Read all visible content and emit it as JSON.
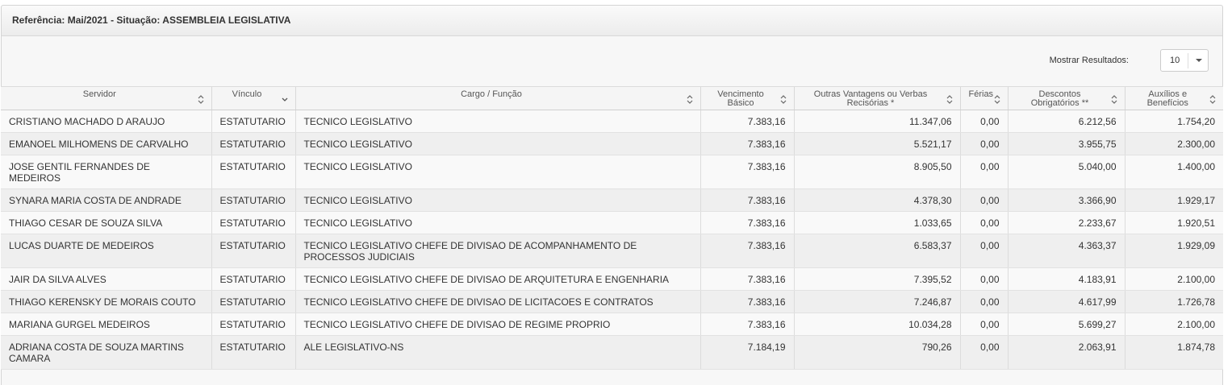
{
  "panel": {
    "title": "Referência: Mai/2021 - Situação: ASSEMBLEIA LEGISLATIVA"
  },
  "toolbar": {
    "show_results_label": "Mostrar Resultados:",
    "page_size": "10"
  },
  "table": {
    "columns": [
      {
        "label": "Servidor",
        "sort": "both"
      },
      {
        "label": "Vínculo",
        "sort": "down"
      },
      {
        "label": "Cargo / Função",
        "sort": "both"
      },
      {
        "label": "Vencimento Básico",
        "sort": "both"
      },
      {
        "label": "Outras Vantagens ou Verbas Recisórias *",
        "sort": "both"
      },
      {
        "label": "Férias",
        "sort": "both"
      },
      {
        "label": "Descontos Obrigatórios **",
        "sort": "both"
      },
      {
        "label": "Auxílios e Benefícios",
        "sort": "both"
      }
    ],
    "rows": [
      [
        "CRISTIANO MACHADO D ARAUJO",
        "ESTATUTARIO",
        "TECNICO LEGISLATIVO",
        "7.383,16",
        "11.347,06",
        "0,00",
        "6.212,56",
        "1.754,20"
      ],
      [
        "EMANOEL MILHOMENS DE CARVALHO",
        "ESTATUTARIO",
        "TECNICO LEGISLATIVO",
        "7.383,16",
        "5.521,17",
        "0,00",
        "3.955,75",
        "2.300,00"
      ],
      [
        "JOSE GENTIL FERNANDES DE MEDEIROS",
        "ESTATUTARIO",
        "TECNICO LEGISLATIVO",
        "7.383,16",
        "8.905,50",
        "0,00",
        "5.040,00",
        "1.400,00"
      ],
      [
        "SYNARA MARIA COSTA DE ANDRADE",
        "ESTATUTARIO",
        "TECNICO LEGISLATIVO",
        "7.383,16",
        "4.378,30",
        "0,00",
        "3.366,90",
        "1.929,17"
      ],
      [
        "THIAGO CESAR DE SOUZA SILVA",
        "ESTATUTARIO",
        "TECNICO LEGISLATIVO",
        "7.383,16",
        "1.033,65",
        "0,00",
        "2.233,67",
        "1.920,51"
      ],
      [
        "LUCAS DUARTE DE MEDEIROS",
        "ESTATUTARIO",
        "TECNICO LEGISLATIVO CHEFE DE DIVISAO DE ACOMPANHAMENTO DE PROCESSOS JUDICIAIS",
        "7.383,16",
        "6.583,37",
        "0,00",
        "4.363,37",
        "1.929,09"
      ],
      [
        "JAIR DA SILVA ALVES",
        "ESTATUTARIO",
        "TECNICO LEGISLATIVO CHEFE DE DIVISAO DE ARQUITETURA E ENGENHARIA",
        "7.383,16",
        "7.395,52",
        "0,00",
        "4.183,91",
        "2.100,00"
      ],
      [
        "THIAGO KERENSKY DE MORAIS COUTO",
        "ESTATUTARIO",
        "TECNICO LEGISLATIVO CHEFE DE DIVISAO DE LICITACOES E CONTRATOS",
        "7.383,16",
        "7.246,87",
        "0,00",
        "4.617,99",
        "1.726,78"
      ],
      [
        "MARIANA GURGEL MEDEIROS",
        "ESTATUTARIO",
        "TECNICO LEGISLATIVO CHEFE DE DIVISAO DE REGIME PROPRIO",
        "7.383,16",
        "10.034,28",
        "0,00",
        "5.699,27",
        "2.100,00"
      ],
      [
        "ADRIANA COSTA DE SOUZA MARTINS CAMARA",
        "ESTATUTARIO",
        "ALE LEGISLATIVO-NS",
        "7.184,19",
        "790,26",
        "0,00",
        "2.063,91",
        "1.874,78"
      ]
    ]
  }
}
